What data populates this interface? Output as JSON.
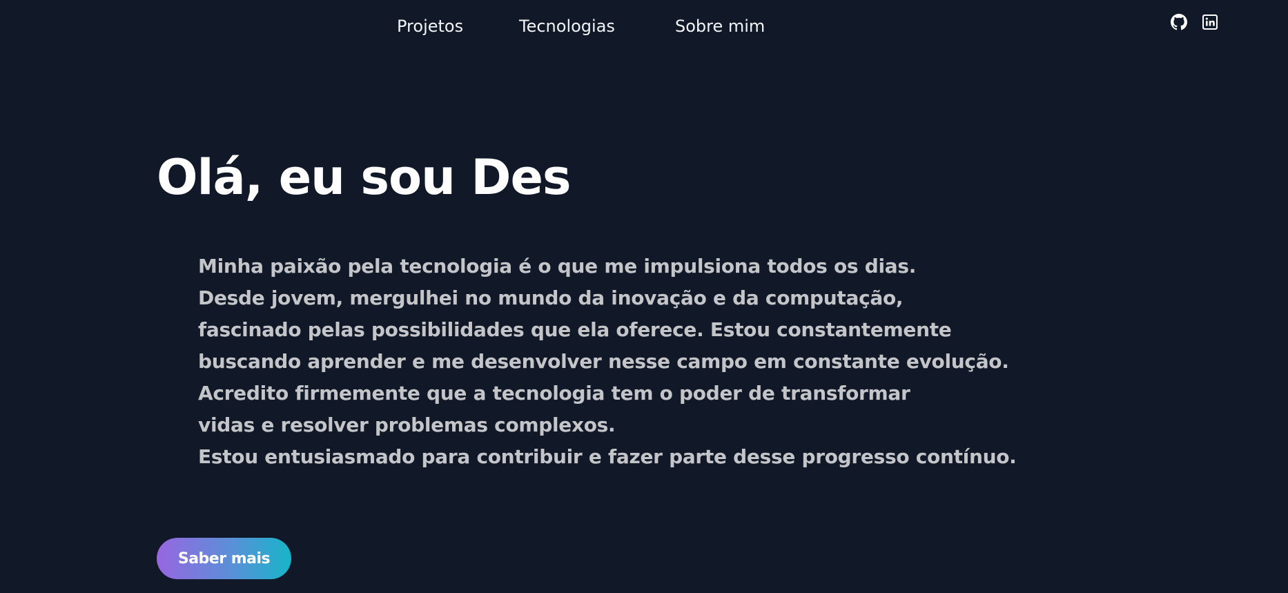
{
  "nav": {
    "links": [
      {
        "label": "Projetos"
      },
      {
        "label": "Tecnologias"
      },
      {
        "label": "Sobre mim"
      }
    ],
    "social": [
      {
        "icon": "github-icon"
      },
      {
        "icon": "linkedin-icon"
      }
    ]
  },
  "hero": {
    "title": "Olá, eu sou Des",
    "intro_lines": [
      "Minha paixão pela tecnologia é o que me impulsiona todos os dias.",
      "Desde jovem, mergulhei no mundo da inovação e da computação,",
      "fascinado pelas possibilidades que ela oferece. Estou constantemente",
      "buscando aprender e me desenvolver nesse campo em constante evolução.",
      "Acredito firmemente que a tecnologia tem o poder de transformar",
      "vidas e resolver problemas complexos.",
      "Estou entusiasmado para contribuir e fazer parte desse progresso contínuo."
    ],
    "cta_label": "Saber mais"
  },
  "colors": {
    "background": "#111827",
    "title": "#ffffff",
    "body_text": "#c4c5c8",
    "cta_gradient_start": "#9866e0",
    "cta_gradient_end": "#17b5c9"
  }
}
